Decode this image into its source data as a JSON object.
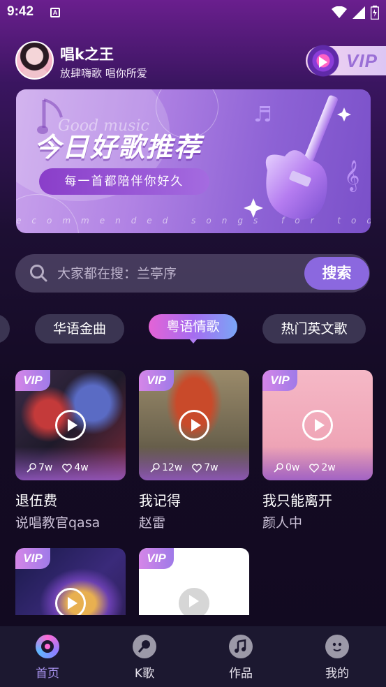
{
  "status_bar": {
    "time": "9:42",
    "notification_letter": "A"
  },
  "header": {
    "username": "唱k之王",
    "slogan": "放肆嗨歌 唱你所爱",
    "vip_label": "VIP"
  },
  "banner": {
    "title": "今日好歌推荐",
    "script_text": "Good music",
    "pill_text": "每一首都陪伴你好久",
    "caption": "ecommended songs for today"
  },
  "search": {
    "placeholder": "大家都在搜：兰亭序",
    "button_label": "搜索"
  },
  "categories": {
    "items": [
      "华语金曲",
      "粤语情歌",
      "热门英文歌"
    ],
    "selected": "粤语情歌"
  },
  "songs": [
    {
      "vip": "VIP",
      "title": "退伍费",
      "artist": "说唱教官qasa",
      "sing_count": "7w",
      "like_count": "4w"
    },
    {
      "vip": "VIP",
      "title": "我记得",
      "artist": "赵雷",
      "sing_count": "12w",
      "like_count": "7w"
    },
    {
      "vip": "VIP",
      "title": "我只能离开",
      "artist": "颜人中",
      "sing_count": "0w",
      "like_count": "2w"
    },
    {
      "vip": "VIP",
      "title": "",
      "artist": "",
      "sing_count": "",
      "like_count": ""
    },
    {
      "vip": "VIP",
      "title": "",
      "artist": "",
      "sing_count": "",
      "like_count": ""
    }
  ],
  "nav": {
    "items": [
      {
        "label": "首页",
        "icon": "music-disc-icon"
      },
      {
        "label": "K歌",
        "icon": "microphone-icon"
      },
      {
        "label": "作品",
        "icon": "music-note-icon"
      },
      {
        "label": "我的",
        "icon": "profile-face-icon"
      }
    ],
    "active": "首页",
    "active_color": "#a892ee"
  },
  "colors": {
    "accent": "#8b68df",
    "vip_gradient_start": "#d586e8",
    "vip_gradient_end": "#9f7ae8"
  }
}
